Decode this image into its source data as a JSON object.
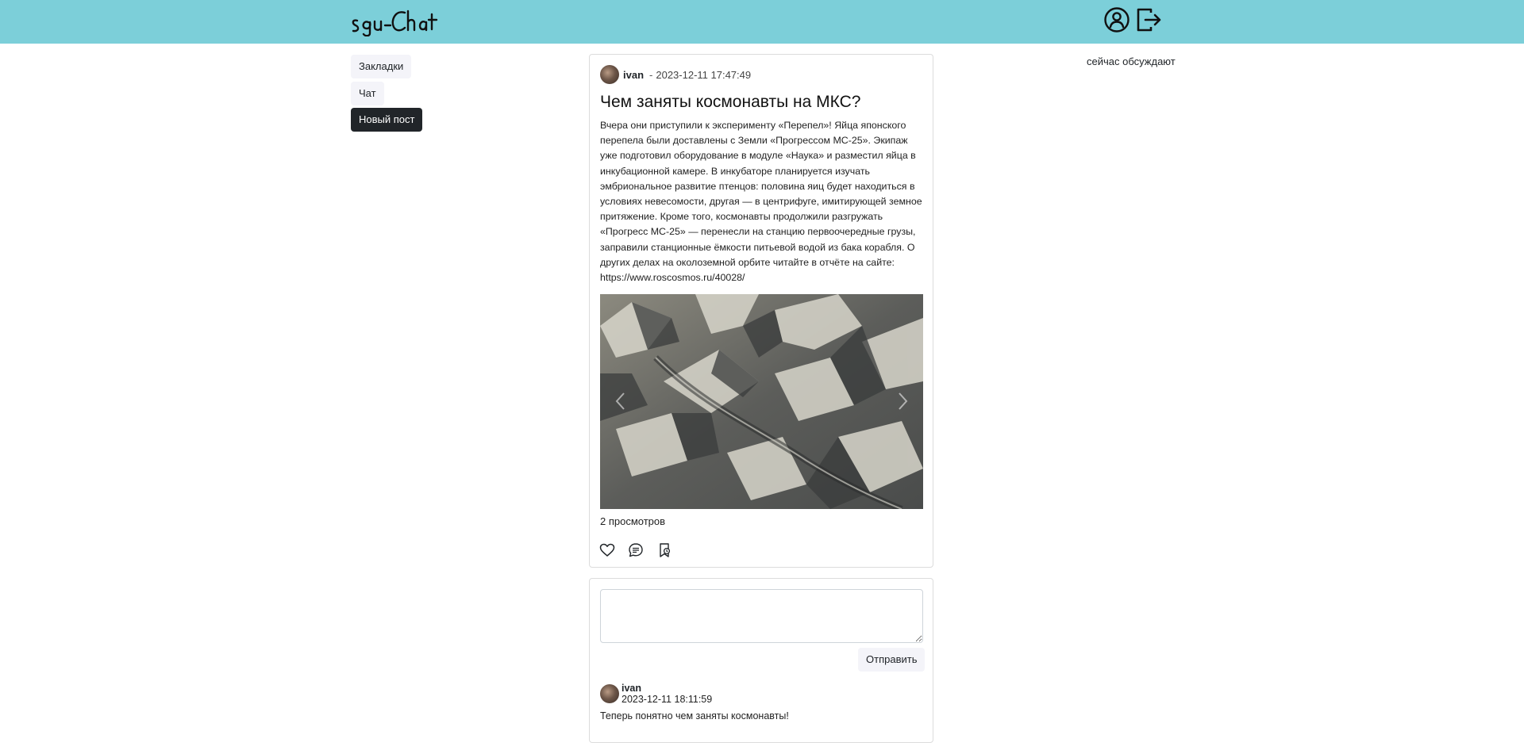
{
  "header": {
    "logo_text": "sgu-chat",
    "icons": [
      "profile-icon",
      "logout-icon"
    ]
  },
  "colors": {
    "header_bg": "#7ccfd9",
    "primary_dark": "#212529",
    "light_button": "#f4f4f9"
  },
  "nav": {
    "bookmarks": "Закладки",
    "chat": "Чат",
    "new_post": "Новый пост"
  },
  "sidebar_right": {
    "trending_title": "сейчас обсуждают"
  },
  "post": {
    "author": "ivan",
    "separator": "-",
    "date": "2023-12-11 17:47:49",
    "title": "Чем заняты космонавты на МКС?",
    "body": "Вчера они приступили к эксперименту «Перепел»! Яйца японского перепела были доставлены с Земли «Прогрессом МС-25». Экипаж уже подготовил оборудование в модуле «Наука» и разместил яйца в инкубационной камере. В инкубаторе планируется изучать эмбриональное развитие птенцов: половина яиц будет находиться в условиях невесомости, другая — в центрифуге, имитирующей земное притяжение. Кроме того, космонавты продолжили разгружать «Прогресс МС-25» — перенесли на станцию первоочередные грузы, заправили станционные ёмкости питьевой водой из бака корабля. О других делах на околоземной орбите читайте в отчёте на сайте: https://www.roscosmos.ru/40028/",
    "views": "2 просмотров",
    "actions": [
      "heart-icon",
      "comment-icon",
      "bookmark-icon"
    ]
  },
  "comment_form": {
    "placeholder": "",
    "value": "",
    "submit_label": "Отправить"
  },
  "comments": [
    {
      "author": "ivan",
      "date": "2023-12-11 18:11:59",
      "text": "Теперь понятно чем заняты космонавты!"
    }
  ]
}
